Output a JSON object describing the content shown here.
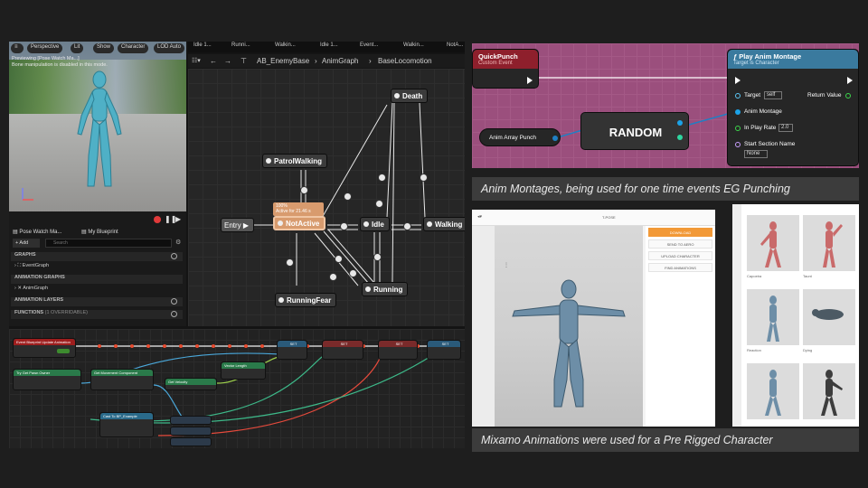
{
  "editor": {
    "viewport": {
      "buttons": [
        "Perspective",
        "Lit",
        "Show",
        "Character",
        "LOD Auto"
      ],
      "messages": [
        "Previewing [Pose Watch Ma...]",
        "Bone manipulation is disabled in this mode."
      ]
    },
    "graph_tabs": [
      "Idle 1...",
      "Runni...",
      "Walkin...",
      "Idle 1...",
      "Event...",
      "Walkin...",
      "NotA..."
    ],
    "breadcrumb": {
      "asset": "AB_EnemyBase",
      "graph": "AnimGraph",
      "state_machine": "BaseLocomotion"
    },
    "states": {
      "entry": "Entry",
      "not_active": "NotActive",
      "patrol_walking": "PatrolWalking",
      "death": "Death",
      "idle": "Idle",
      "walking": "Walking",
      "running": "Running",
      "running_fear": "RunningFear",
      "active_note": "100%",
      "active_note2": "Active for 21.46 s"
    },
    "panel": {
      "tab1": "Pose Watch Ma...",
      "tab2": "My Blueprint",
      "add_label": "+ Add",
      "search_placeholder": "Search",
      "sections": [
        "GRAPHS",
        "ANIMATION GRAPHS",
        "ANIMATION LAYERS",
        "FUNCTIONS"
      ],
      "items": [
        "EventGraph",
        "AnimGraph"
      ],
      "functions_note": "(1 OVERRIDABLE)"
    },
    "blueprint": {
      "event_node": "Event Blueprint Update Animation",
      "set_labels": [
        "SET",
        "SET",
        "SET",
        "SET"
      ],
      "nodes": [
        "Try Get Pawn Owner",
        "Get Movement Component",
        "Get Velocity",
        "Vector Length",
        "Cast To BP_Example"
      ]
    }
  },
  "montage": {
    "event_title": "QuickPunch",
    "event_sub": "Custom Event",
    "array_label": "Anim Array Punch",
    "random_label": "RANDOM",
    "play_title": "Play Anim Montage",
    "play_sub": "Target is Character",
    "target_label": "Target",
    "target_value": "self",
    "return_label": "Return Value",
    "anim_montage_label": "Anim Montage",
    "play_rate_label": "In Play Rate",
    "play_rate_value": "2.0",
    "section_label": "Start Section Name",
    "section_value": "None"
  },
  "captions": {
    "montage": "Anim Montages, being used for one time events EG Punching",
    "mixamo": "Mixamo Animations were used for a Pre Rigged Character"
  },
  "mixamo": {
    "title": "T-POSE",
    "buttons": [
      "DOWNLOAD",
      "SEND TO AERO",
      "UPLOAD CHARACTER",
      "FIND ANIMATIONS"
    ]
  },
  "thumbs": {
    "labels": [
      "Capoeira",
      "Taunt",
      "Reaction",
      "Dying"
    ]
  }
}
